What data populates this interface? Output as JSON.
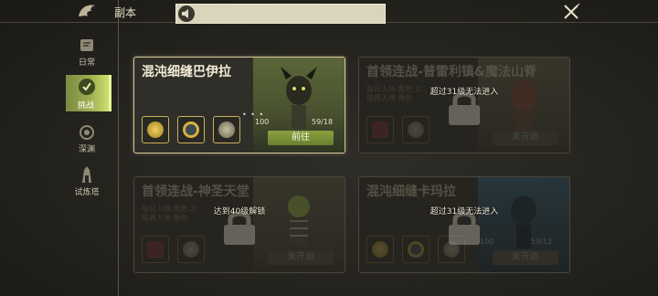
{
  "header": {
    "title": "副本",
    "notice_text": ""
  },
  "sidebar": {
    "items": [
      {
        "label": "日常",
        "icon": "scroll-icon"
      },
      {
        "label": "挑战",
        "icon": "shield-icon"
      },
      {
        "label": "深渊",
        "icon": "vortex-icon"
      },
      {
        "label": "试炼塔",
        "icon": "tower-icon"
      }
    ],
    "active_index": 1
  },
  "cards": [
    {
      "title": "混沌细缝巴伊拉",
      "power": "100",
      "count": "59/18",
      "button": "前往",
      "locked": false,
      "lock_message": "",
      "info_line1": "",
      "info_line2": ""
    },
    {
      "title": "首领连战-普雷利镇&魔法山脊",
      "power": "",
      "count": "",
      "button": "未开启",
      "locked": true,
      "lock_message": "超过31级无法进入",
      "info_line1": "每日入场 角色 1/",
      "info_line2": "每周入场 角色"
    },
    {
      "title": "首领连战-神圣天堂",
      "power": "",
      "count": "",
      "button": "未开启",
      "locked": true,
      "lock_message": "达到40级解锁",
      "info_line1": "每日入场 角色 3/",
      "info_line2": "每周入场 角色"
    },
    {
      "title": "混沌细缝卡玛拉",
      "power": "100",
      "count": "59/12",
      "button": "未开启",
      "locked": true,
      "lock_message": "超过31级无法进入",
      "info_line1": "",
      "info_line2": ""
    }
  ],
  "colors": {
    "accent": "#8aa040",
    "active_border": "#d8c89a",
    "bg": "#24231e"
  }
}
